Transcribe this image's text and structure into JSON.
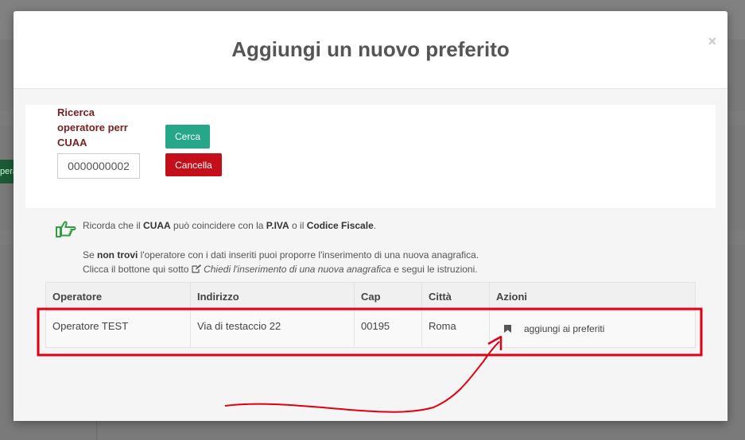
{
  "background": {
    "green_button_fragment": "pera"
  },
  "modal": {
    "title": "Aggiungi un nuovo preferito",
    "close_glyph": "×"
  },
  "search": {
    "label": "Ricerca operatore perr CUAA",
    "input_value": "0000000002",
    "search_button": "Cerca",
    "cancel_button": "Cancella"
  },
  "info": {
    "line1": {
      "t1": "Ricorda che il ",
      "b1": "CUAA",
      "t2": " può coincidere con la ",
      "b2": "P.IVA",
      "t3": " o il ",
      "b3": "Codice Fiscale",
      "t4": "."
    },
    "line2": {
      "t1": "Se ",
      "b1": "non trovi",
      "t2": " l'operatore con i dati inseriti puoi proporre l'inserimento di una nuova anagrafica."
    },
    "line3": {
      "t1": "Clicca il bottone qui sotto ",
      "i1": "Chiedi l'inserimento di una nuova anagrafica",
      "t2": " e segui le istruzioni."
    }
  },
  "table": {
    "headers": [
      "Operatore",
      "Indirizzo",
      "Cap",
      "Città",
      "Azioni"
    ],
    "rows": [
      {
        "operatore": "Operatore TEST",
        "indirizzo": "Via di testaccio 22",
        "cap": "00195",
        "citta": "Roma",
        "azione": "aggiungi ai preferiti"
      }
    ]
  },
  "colors": {
    "search_button": "#26a78a",
    "cancel_button": "#c40f1a",
    "label": "#7a2020",
    "annotation": "#e0000f",
    "hand_icon": "#2e9e3e"
  },
  "icons": [
    "close-icon",
    "pointing-hand-icon",
    "edit-icon",
    "bookmark-icon"
  ]
}
